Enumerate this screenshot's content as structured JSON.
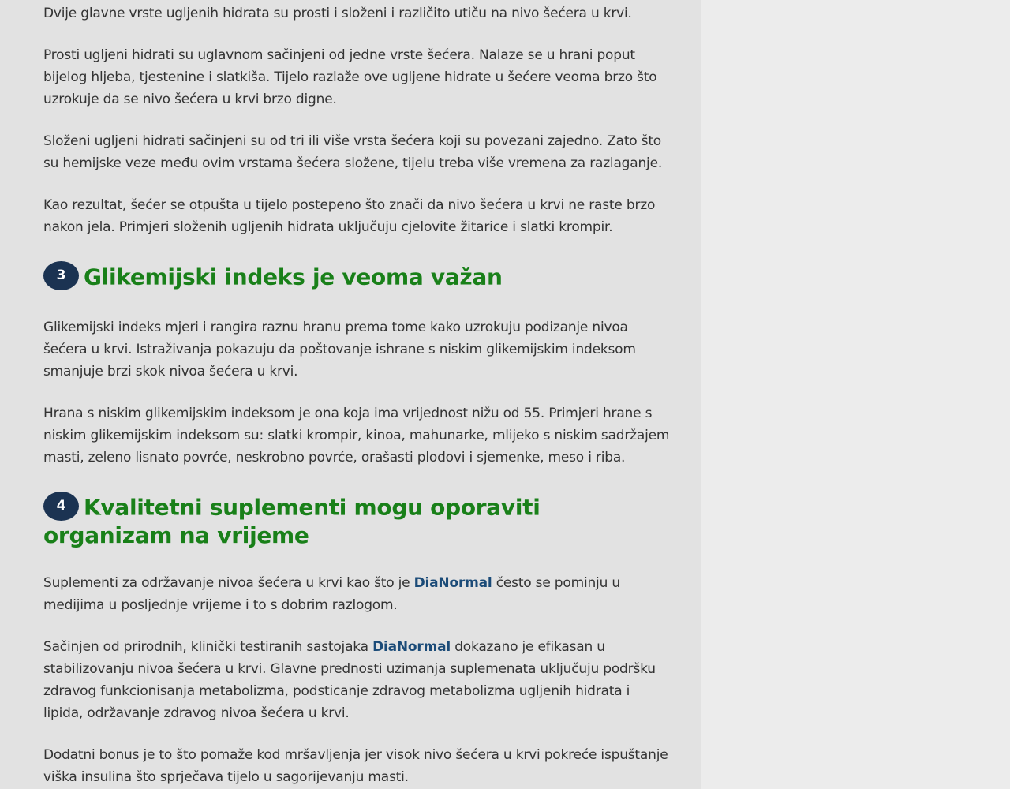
{
  "article": {
    "p1": "Dvije glavne vrste ugljenih hidrata su prosti i složeni i različito utiču na nivo šećera u krvi.",
    "p2": "Prosti ugljeni hidrati su uglavnom sačinjeni od jedne vrste šećera. Nalaze se u hrani poput bijelog hljeba, tjestenine i slatkiša. Tijelo razlaže ove ugljene hidrate u šećere veoma brzo što uzrokuje da se nivo šećera u krvi brzo digne.",
    "p3": "Složeni ugljeni hidrati sačinjeni su od tri ili više vrsta šećera koji su povezani zajedno. Zato što su hemijske veze među ovim vrstama šećera složene, tijelu treba više vremena za razlaganje.",
    "p4": "Kao rezultat, šećer se otpušta u tijelo postepeno što znači da nivo šećera u krvi ne raste brzo nakon jela. Primjeri složenih ugljenih hidrata uključuju cjelovite žitarice i slatki krompir.",
    "section3": {
      "number": "3",
      "title": "Glikemijski indeks je veoma važan",
      "p1": "Glikemijski indeks mjeri i rangira raznu hranu prema tome kako uzrokuju podizanje nivoa šećera u krvi. Istraživanja pokazuju da poštovanje ishrane s niskim glikemijskim indeksom smanjuje brzi skok nivoa šećera u krvi.",
      "p2": "Hrana s niskim glikemijskim indeksom je ona koja ima vrijednost nižu od 55. Primjeri hrane s niskim glikemijskim indeksom su: slatki krompir, kinoa, mahunarke, mlijeko s niskim sadržajem masti, zeleno lisnato povrće, neskrobno povrće, orašasti plodovi i sjemenke, meso i riba."
    },
    "section4": {
      "number": "4",
      "title": "Kvalitetni suplementi mogu oporaviti organizam na vrijeme",
      "p1_before": "Suplementi za održavanje nivoa šećera u krvi kao što je ",
      "p1_brand": "DiaNormal",
      "p1_after": " često se pominju u medijima u posljednje vrijeme i to s dobrim razlogom.",
      "p2_before": "Sačinjen od prirodnih, klinički testiranih sastojaka ",
      "p2_brand": "DiaNormal",
      "p2_after": " dokazano je efikasan u stabilizovanju nivoa šećera u krvi. Glavne prednosti uzimanja suplemenata uključuju podršku zdravog funkcionisanja metabolizma, podsticanje zdravog metabolizma ugljenih hidrata i lipida, održavanje zdravog nivoa šećera u krvi.",
      "p3": "Dodatni bonus je to što pomaže kod mršavljenja jer visok nivo šećera u krvi pokreće ispuštanje viška insulina što sprječava tijelo u sagorijevanju masti."
    }
  },
  "colors": {
    "heading": "#198019",
    "badge": "#1b3352",
    "brand_link": "#1b4b78",
    "body_text": "#333333",
    "content_bg": "#e2e2e2",
    "sidebar_bg": "#ececec"
  }
}
